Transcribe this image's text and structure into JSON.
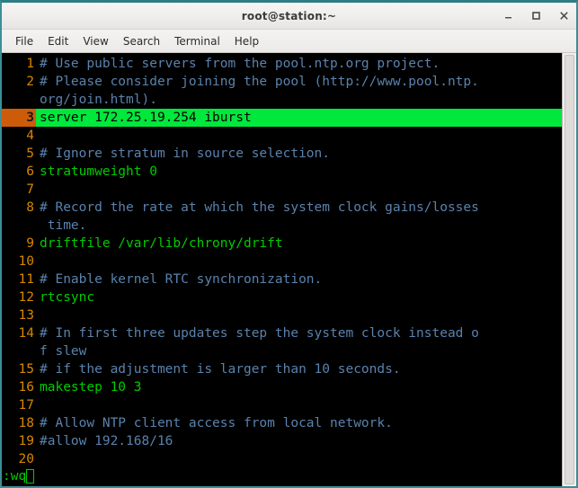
{
  "window": {
    "title": "root@station:~",
    "controls": [
      {
        "name": "minimize",
        "label": "–"
      },
      {
        "name": "maximize",
        "label": "□"
      },
      {
        "name": "close",
        "label": "×"
      }
    ]
  },
  "menubar": {
    "items": [
      {
        "label": "File"
      },
      {
        "label": "Edit"
      },
      {
        "label": "View"
      },
      {
        "label": "Search"
      },
      {
        "label": "Terminal"
      },
      {
        "label": "Help"
      }
    ]
  },
  "colors": {
    "background": "#000000",
    "line_number": "#d78700",
    "current_line_number_bg": "#cd5c0a",
    "comment": "#5a82ad",
    "code": "#00cc00",
    "highlight_bg": "#00e83c",
    "highlight_fg": "#000000",
    "titlebar_bg": "#f2f1f0",
    "window_border": "#3b8f96"
  },
  "editor": {
    "rows": [
      {
        "num": "1",
        "text": "# Use public servers from the pool.ntp.org project.",
        "style": "comment",
        "current": false
      },
      {
        "num": "2",
        "text": "# Please consider joining the pool (http://www.pool.ntp.",
        "style": "comment",
        "current": false
      },
      {
        "num": "",
        "text": "org/join.html).",
        "style": "comment",
        "current": false
      },
      {
        "num": "3",
        "text": "server 172.25.19.254 iburst",
        "style": "highlight",
        "current": true
      },
      {
        "num": "4",
        "text": "",
        "style": "code",
        "current": false
      },
      {
        "num": "5",
        "text": "# Ignore stratum in source selection.",
        "style": "comment",
        "current": false
      },
      {
        "num": "6",
        "text": "stratumweight 0",
        "style": "code",
        "current": false
      },
      {
        "num": "7",
        "text": "",
        "style": "code",
        "current": false
      },
      {
        "num": "8",
        "text": "# Record the rate at which the system clock gains/losses",
        "style": "comment",
        "current": false
      },
      {
        "num": "",
        "text": " time.",
        "style": "comment",
        "current": false
      },
      {
        "num": "9",
        "text": "driftfile /var/lib/chrony/drift",
        "style": "code",
        "current": false
      },
      {
        "num": "10",
        "text": "",
        "style": "code",
        "current": false
      },
      {
        "num": "11",
        "text": "# Enable kernel RTC synchronization.",
        "style": "comment",
        "current": false
      },
      {
        "num": "12",
        "text": "rtcsync",
        "style": "code",
        "current": false
      },
      {
        "num": "13",
        "text": "",
        "style": "code",
        "current": false
      },
      {
        "num": "14",
        "text": "# In first three updates step the system clock instead o",
        "style": "comment",
        "current": false
      },
      {
        "num": "",
        "text": "f slew",
        "style": "comment",
        "current": false
      },
      {
        "num": "15",
        "text": "# if the adjustment is larger than 10 seconds.",
        "style": "comment",
        "current": false
      },
      {
        "num": "16",
        "text": "makestep 10 3",
        "style": "code",
        "current": false
      },
      {
        "num": "17",
        "text": "",
        "style": "code",
        "current": false
      },
      {
        "num": "18",
        "text": "# Allow NTP client access from local network.",
        "style": "comment",
        "current": false
      },
      {
        "num": "19",
        "text": "#allow 192.168/16",
        "style": "comment",
        "current": false
      },
      {
        "num": "20",
        "text": "",
        "style": "code",
        "current": false
      }
    ],
    "command_line": ":wq"
  }
}
